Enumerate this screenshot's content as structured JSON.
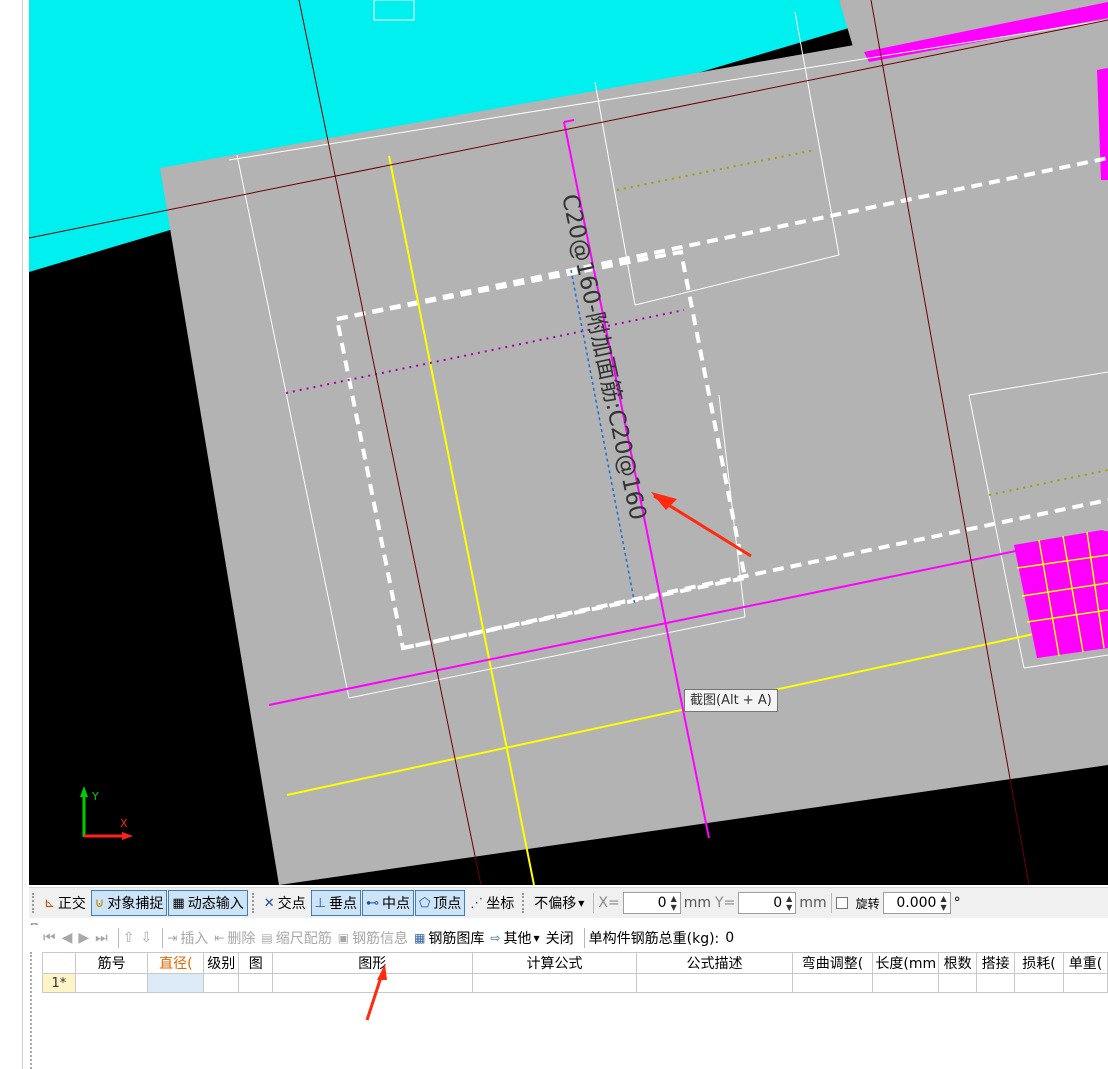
{
  "canvas": {
    "label_text": "C20@160-附加面筋:C20@160",
    "tooltip": "截图(Alt + A)",
    "axis_y": "Y",
    "axis_x": "X",
    "colors": {
      "background": "#000000",
      "slab": "#b3b3b3",
      "cyan_region": "#00f0f0",
      "magenta": "#ff00ff",
      "yellow": "#ffff00",
      "axis_line": "#8b0000",
      "annotation_arrow": "#ff3010"
    }
  },
  "status_bar": {
    "ortho": "正交",
    "snap": "对象捕捉",
    "dynamic_input": "动态输入",
    "intersection": "交点",
    "perpendicular": "垂点",
    "midpoint": "中点",
    "vertex": "顶点",
    "coordinate": "坐标",
    "offset_select": "不偏移",
    "x_label": "X=",
    "x_value": "0",
    "x_unit": "mm",
    "y_label": "Y=",
    "y_value": "0",
    "y_unit": "mm",
    "rotate": "旋转",
    "rotate_value": "0.000",
    "degree": "°"
  },
  "rebar_toolbar": {
    "insert": "插入",
    "delete": "删除",
    "scale_rebar": "缩尺配筋",
    "rebar_info": "钢筋信息",
    "rebar_library": "钢筋图库",
    "other": "其他",
    "close": "关闭",
    "total_weight_label": "单构件钢筋总重(kg):",
    "total_weight_value": "0"
  },
  "grid": {
    "columns": [
      "筋号",
      "直径(",
      "级别",
      "图",
      "图形",
      "计算公式",
      "公式描述",
      "弯曲调整(",
      "长度(mm",
      "根数",
      "搭接",
      "损耗(",
      "单重("
    ],
    "rows": [
      {
        "no": "1*"
      }
    ]
  }
}
